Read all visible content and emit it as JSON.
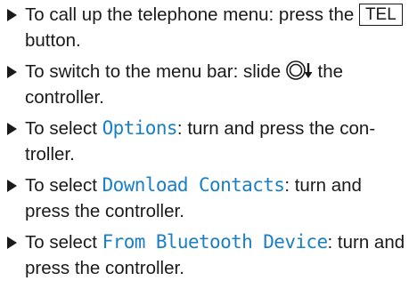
{
  "steps": [
    {
      "before": "To call up the telephone menu: press the ",
      "key": "TEL",
      "after": " button."
    },
    {
      "before": "To switch to the menu bar: slide ",
      "icon": "controller-slide-down-icon",
      "after": " the controller."
    },
    {
      "before": "To select ",
      "menu": "Options",
      "after": ": turn and press the con­troller."
    },
    {
      "before": "To select ",
      "menu": "Download Contacts",
      "after": ": turn and press the controller."
    },
    {
      "before": "To select ",
      "menu": "From Bluetooth Device",
      "after": ": turn and press the controller."
    }
  ],
  "colors": {
    "menu_text": "#1a7fc4",
    "body_text": "#1a1a1a"
  }
}
